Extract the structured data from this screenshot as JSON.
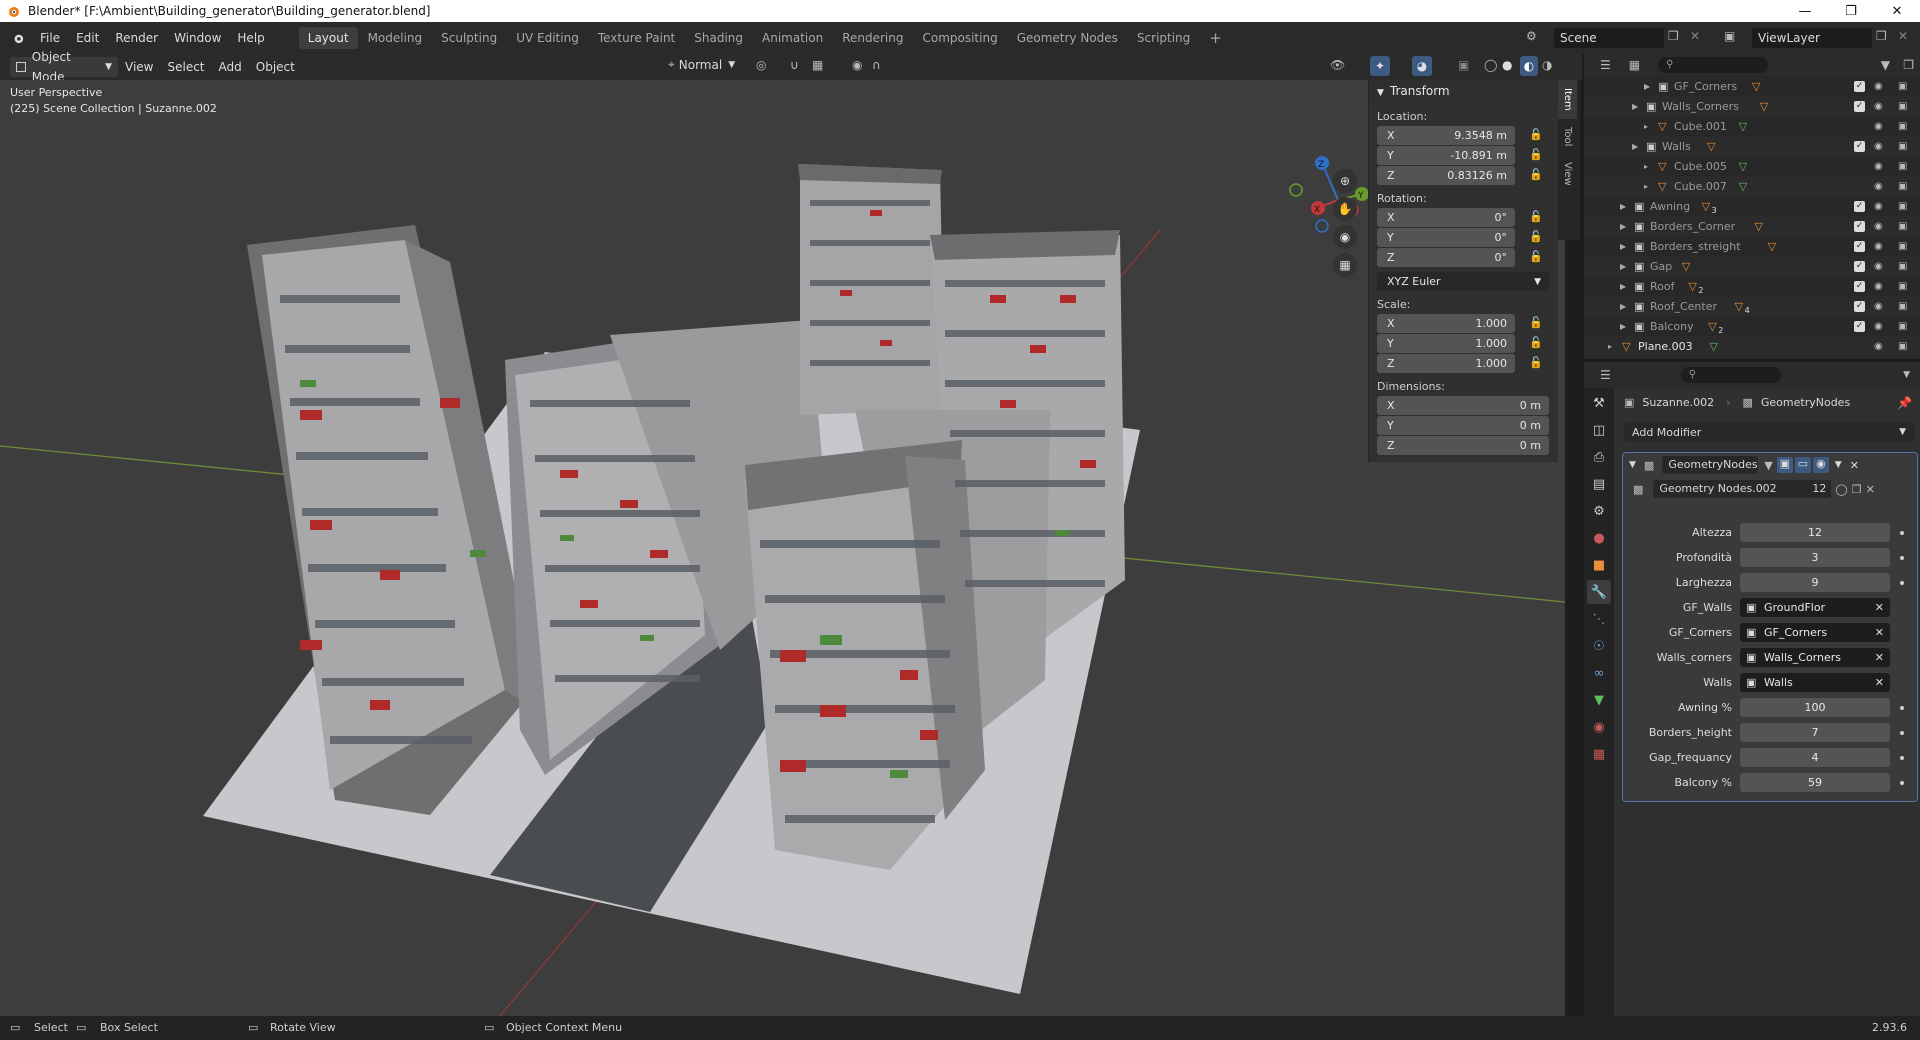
{
  "window": {
    "title": "Blender* [F:\\Ambient\\Building_generator\\Building_generator.blend]"
  },
  "menu": [
    "File",
    "Edit",
    "Render",
    "Window",
    "Help"
  ],
  "workspaces": [
    "Layout",
    "Modeling",
    "Sculpting",
    "UV Editing",
    "Texture Paint",
    "Shading",
    "Animation",
    "Rendering",
    "Compositing",
    "Geometry Nodes",
    "Scripting"
  ],
  "active_workspace": "Layout",
  "scene": "Scene",
  "view_layer": "ViewLayer",
  "viewport_header": {
    "mode": "Object Mode",
    "menus": [
      "View",
      "Select",
      "Add",
      "Object"
    ],
    "orientation": "Normal"
  },
  "viewport": {
    "perspective": "User Perspective",
    "collection_info": "(225) Scene Collection | Suzanne.002",
    "gizmo": {
      "z": "Z",
      "y": "Y",
      "x": "X"
    }
  },
  "n_panel": {
    "title": "Transform",
    "location_label": "Location:",
    "location": [
      {
        "axis": "X",
        "value": "9.3548 m"
      },
      {
        "axis": "Y",
        "value": "-10.891 m"
      },
      {
        "axis": "Z",
        "value": "0.83126 m"
      }
    ],
    "rotation_label": "Rotation:",
    "rotation": [
      {
        "axis": "X",
        "value": "0°"
      },
      {
        "axis": "Y",
        "value": "0°"
      },
      {
        "axis": "Z",
        "value": "0°"
      }
    ],
    "rotation_mode": "XYZ Euler",
    "scale_label": "Scale:",
    "scale": [
      {
        "axis": "X",
        "value": "1.000"
      },
      {
        "axis": "Y",
        "value": "1.000"
      },
      {
        "axis": "Z",
        "value": "1.000"
      }
    ],
    "dimensions_label": "Dimensions:",
    "dimensions": [
      {
        "axis": "X",
        "value": "0 m"
      },
      {
        "axis": "Y",
        "value": "0 m"
      },
      {
        "axis": "Z",
        "value": "0 m"
      }
    ],
    "tabs": [
      "Item",
      "Tool",
      "View"
    ]
  },
  "outliner": {
    "rows": [
      {
        "name": "GF_Corners",
        "kind": "collection",
        "badge": ""
      },
      {
        "name": "Walls_Corners",
        "kind": "collection",
        "badge": ""
      },
      {
        "name": "Cube.001",
        "kind": "object",
        "badge": ""
      },
      {
        "name": "Walls",
        "kind": "collection",
        "badge": ""
      },
      {
        "name": "Cube.005",
        "kind": "object",
        "badge": ""
      },
      {
        "name": "Cube.007",
        "kind": "object",
        "badge": ""
      },
      {
        "name": "Awning",
        "kind": "collection",
        "badge": "3"
      },
      {
        "name": "Borders_Corner",
        "kind": "collection",
        "badge": ""
      },
      {
        "name": "Borders_streight",
        "kind": "collection",
        "badge": ""
      },
      {
        "name": "Gap",
        "kind": "collection",
        "badge": ""
      },
      {
        "name": "Roof",
        "kind": "collection",
        "badge": "2"
      },
      {
        "name": "Roof_Center",
        "kind": "collection",
        "badge": "4"
      },
      {
        "name": "Balcony",
        "kind": "collection",
        "badge": "2"
      },
      {
        "name": "Plane.003",
        "kind": "object",
        "badge": ""
      }
    ]
  },
  "properties": {
    "object": "Suzanne.002",
    "modifier_name": "GeometryNodes",
    "add_modifier": "Add Modifier",
    "node_group": "Geometry Nodes.002",
    "users": "12",
    "params": [
      {
        "label": "Altezza",
        "value": "12",
        "type": "num"
      },
      {
        "label": "Profondità",
        "value": "3",
        "type": "num"
      },
      {
        "label": "Larghezza",
        "value": "9",
        "type": "num"
      },
      {
        "label": "GF_Walls",
        "value": "GroundFlor",
        "type": "obj"
      },
      {
        "label": "GF_Corners",
        "value": "GF_Corners",
        "type": "obj"
      },
      {
        "label": "Walls_corners",
        "value": "Walls_Corners",
        "type": "obj"
      },
      {
        "label": "Walls",
        "value": "Walls",
        "type": "obj"
      },
      {
        "label": "Awning %",
        "value": "100",
        "type": "num"
      },
      {
        "label": "Borders_height",
        "value": "7",
        "type": "num"
      },
      {
        "label": "Gap_frequancy",
        "value": "4",
        "type": "num"
      },
      {
        "label": "Balcony %",
        "value": "59",
        "type": "num"
      }
    ]
  },
  "statusbar": {
    "select": "Select",
    "box_select": "Box Select",
    "rotate": "Rotate View",
    "context": "Object Context Menu",
    "version": "2.93.6"
  }
}
